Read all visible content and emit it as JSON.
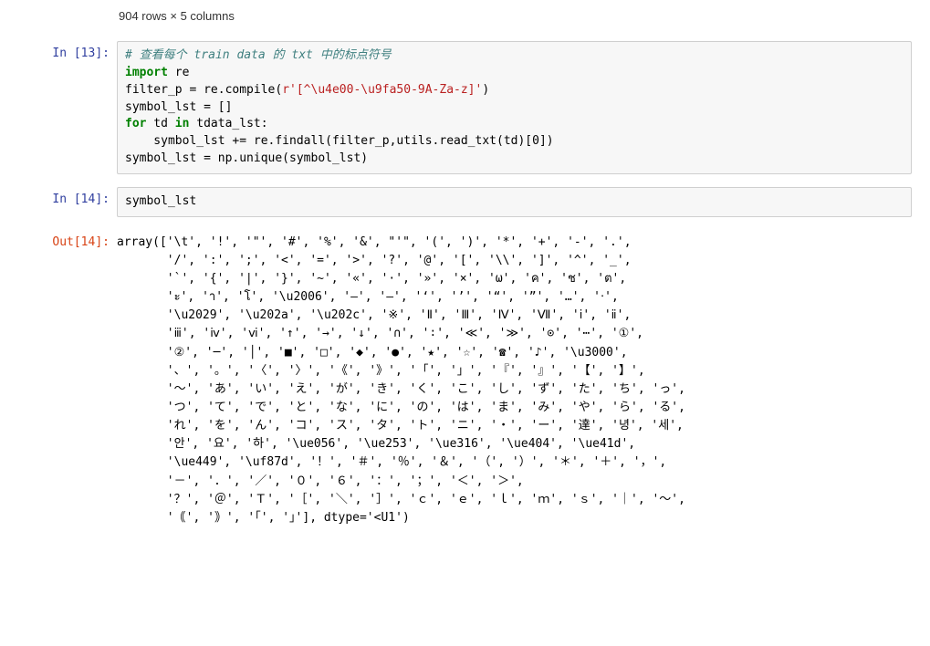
{
  "dim_info": "904 rows × 5 columns",
  "cells": [
    {
      "kind": "input",
      "prompt": "In [13]:",
      "segments": [
        {
          "cls": "c-comment",
          "text": "# 查看每个 train data 的 txt 中的标点符号"
        },
        {
          "cls": "",
          "text": "\n"
        },
        {
          "cls": "c-kw",
          "text": "import"
        },
        {
          "cls": "",
          "text": " re\nfilter_p = re.compile("
        },
        {
          "cls": "c-str",
          "text": "r'[^\\u4e00-\\u9fa50-9A-Za-z]'"
        },
        {
          "cls": "",
          "text": ")\nsymbol_lst = []\n"
        },
        {
          "cls": "c-kw",
          "text": "for"
        },
        {
          "cls": "",
          "text": " td "
        },
        {
          "cls": "c-kw",
          "text": "in"
        },
        {
          "cls": "",
          "text": " tdata_lst:\n    symbol_lst += re.findall(filter_p,utils.read_txt(td)[0])\nsymbol_lst = np.unique(symbol_lst)"
        }
      ]
    },
    {
      "kind": "input",
      "prompt": "In [14]:",
      "segments": [
        {
          "cls": "",
          "text": "symbol_lst"
        }
      ]
    },
    {
      "kind": "output",
      "prompt": "Out[14]:",
      "text": "array(['\\t', '!', '\"', '#', '%', '&', \"'\", '(', ')', '*', '+', '-', '.',\n       '/', ':', ';', '<', '=', '>', '?', '@', '[', '\\\\', ']', '^', '_',\n       '`', '{', '|', '}', '~', '«', '·', '»', '×', 'ω', 'ค', 'ช', 'ต',\n       'ะ', 'า', 'โ', '\\u2006', '—', '―', '‘', '’', '“', '”', '…', '‧',\n       '\\u2029', '\\u202a', '\\u202c', '※', 'Ⅱ', 'Ⅲ', 'Ⅳ', 'Ⅶ', 'ⅰ', 'ⅱ',\n       'ⅲ', 'ⅳ', 'ⅵ', '↑', '→', '↓', '∩', '∶', '≪', '≫', '⊙', '⋯', '①',\n       '②', '─', '│', '■', '□', '◆', '●', '★', '☆', '☎', '♪', '\\u3000',\n       '、', '。', '〈', '〉', '《', '》', '「', '」', '『', '』', '【', '】',\n       '〜', 'あ', 'い', 'え', 'が', 'き', 'く', 'こ', 'し', 'ず', 'た', 'ち', 'っ',\n       'つ', 'て', 'で', 'と', 'な', 'に', 'の', 'は', 'ま', 'み', 'や', 'ら', 'る',\n       'れ', 'を', 'ん', 'コ', 'ス', 'タ', 'ト', 'ニ', '・', 'ー', '達', '녕', '세',\n       '안', '요', '하', '\\ue056', '\\ue253', '\\ue316', '\\ue404', '\\ue41d',\n       '\\ue449', '\\uf87d', '！', '＃', '％', '＆', '（', '）', '＊', '＋', '，',\n       '－', '．', '／', '０', '６', '：', '；', '＜', '＞',\n       '？', '＠', 'Ｔ', '［', '＼', '］', 'ｃ', 'ｅ', 'ｌ', 'ｍ', 'ｓ', '｜', '～',\n       '｟', '｠', '｢', '｣'], dtype='<U1')"
    }
  ]
}
